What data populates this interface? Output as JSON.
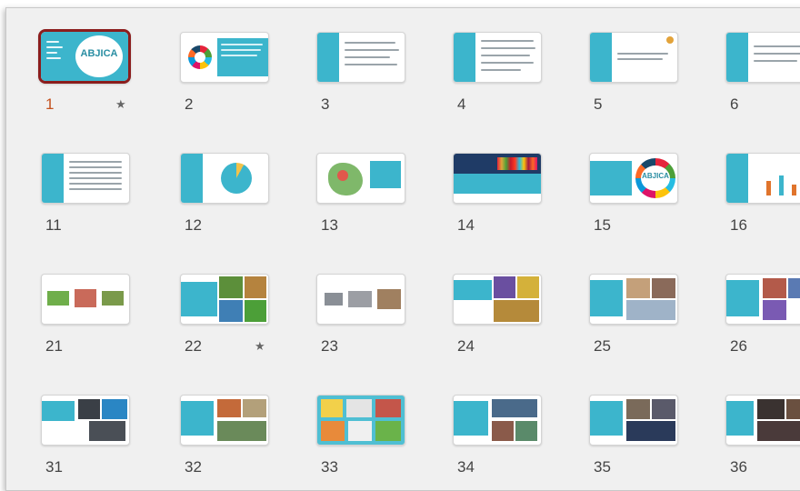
{
  "slides": [
    {
      "num": "1",
      "selected": true,
      "star": true,
      "logo": "ABJICA"
    },
    {
      "num": "2"
    },
    {
      "num": "3"
    },
    {
      "num": "4"
    },
    {
      "num": "5"
    },
    {
      "num": "6"
    },
    {
      "num": "11"
    },
    {
      "num": "12"
    },
    {
      "num": "13"
    },
    {
      "num": "14"
    },
    {
      "num": "15",
      "logo": "ABJICA"
    },
    {
      "num": "16"
    },
    {
      "num": "21"
    },
    {
      "num": "22",
      "star": true
    },
    {
      "num": "23"
    },
    {
      "num": "24"
    },
    {
      "num": "25"
    },
    {
      "num": "26"
    },
    {
      "num": "31"
    },
    {
      "num": "32"
    },
    {
      "num": "33"
    },
    {
      "num": "34"
    },
    {
      "num": "35"
    },
    {
      "num": "36"
    }
  ],
  "star_glyph": "★",
  "colors": {
    "accent": "#3cb5cc",
    "selected_border": "#8b1d1d",
    "active_number": "#c4511e"
  }
}
